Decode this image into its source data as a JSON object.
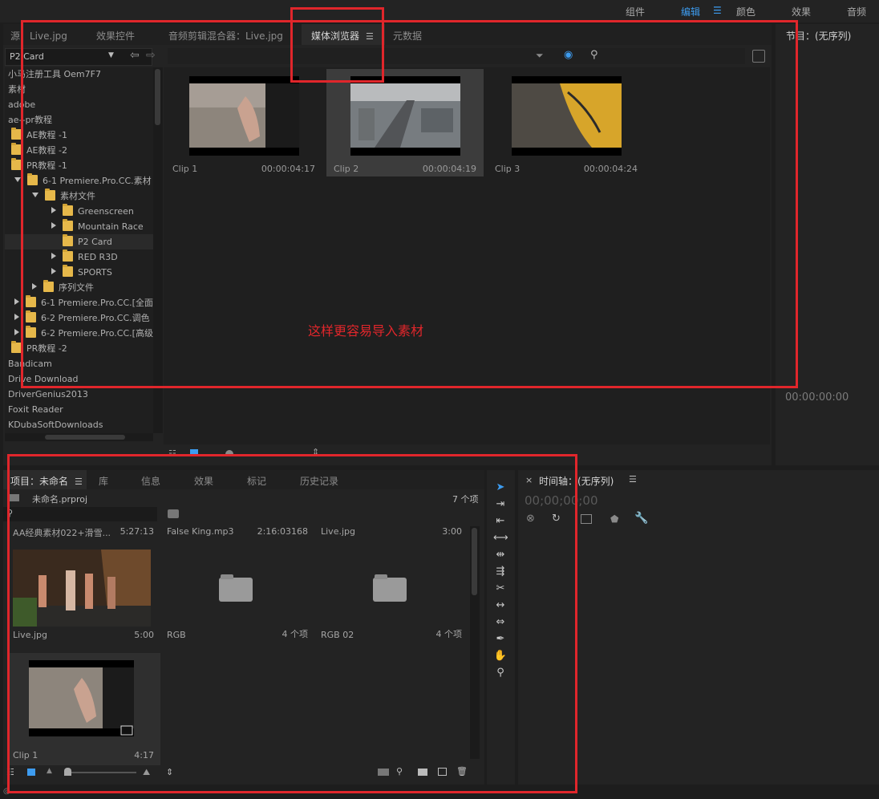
{
  "workspace_menu": {
    "items": [
      "组件",
      "编辑",
      "颜色",
      "效果",
      "音频"
    ],
    "active": "编辑"
  },
  "source_panel": {
    "tabs": [
      "源：Live.jpg",
      "效果控件",
      "音频剪辑混合器：Live.jpg",
      "媒体浏览器",
      "元数据"
    ],
    "active_tab": "媒体浏览器",
    "location_select": "P2 Card",
    "tree": [
      {
        "label": "小马注册工具 Oem7F7",
        "level": 0,
        "folder": false,
        "arrow": ""
      },
      {
        "label": "素材",
        "level": 0,
        "folder": false,
        "arrow": ""
      },
      {
        "label": "adobe",
        "level": 0,
        "folder": false,
        "arrow": ""
      },
      {
        "label": "ae--pr教程",
        "level": 0,
        "folder": false,
        "arrow": ""
      },
      {
        "label": "AE教程 -1",
        "level": 1,
        "folder": true,
        "arrow": ""
      },
      {
        "label": "AE教程 -2",
        "level": 1,
        "folder": true,
        "arrow": ""
      },
      {
        "label": "PR教程 -1",
        "level": 1,
        "folder": true,
        "arrow": ""
      },
      {
        "label": "6-1 Premiere.Pro.CC.素材",
        "level": 2,
        "folder": true,
        "arrow": "down"
      },
      {
        "label": "素材文件",
        "level": 3,
        "folder": true,
        "arrow": "down"
      },
      {
        "label": "Greenscreen",
        "level": 4,
        "folder": true,
        "arrow": "right"
      },
      {
        "label": "Mountain Race",
        "level": 4,
        "folder": true,
        "arrow": "right"
      },
      {
        "label": "P2 Card",
        "level": 4,
        "folder": true,
        "arrow": ""
      },
      {
        "label": "RED R3D",
        "level": 4,
        "folder": true,
        "arrow": "right"
      },
      {
        "label": "SPORTS",
        "level": 4,
        "folder": true,
        "arrow": "right"
      },
      {
        "label": "序列文件",
        "level": 3,
        "folder": true,
        "arrow": "right"
      },
      {
        "label": "6-1 Premiere.Pro.CC.[全面",
        "level": 2,
        "folder": true,
        "arrow": "right"
      },
      {
        "label": "6-2 Premiere.Pro.CC.调色",
        "level": 2,
        "folder": true,
        "arrow": "right"
      },
      {
        "label": "6-2 Premiere.Pro.CC.[高级",
        "level": 2,
        "folder": true,
        "arrow": "right"
      },
      {
        "label": "PR教程 -2",
        "level": 1,
        "folder": true,
        "arrow": ""
      },
      {
        "label": "Bandicam",
        "level": 0,
        "folder": false,
        "arrow": ""
      },
      {
        "label": "Drive Download",
        "level": 0,
        "folder": false,
        "arrow": ""
      },
      {
        "label": "DriverGenius2013",
        "level": 0,
        "folder": false,
        "arrow": ""
      },
      {
        "label": "Foxit Reader",
        "level": 0,
        "folder": false,
        "arrow": ""
      },
      {
        "label": "KDubaSoftDownloads",
        "level": 0,
        "folder": false,
        "arrow": ""
      }
    ],
    "clips": [
      {
        "name": "Clip 1",
        "duration": "00:00:04:17"
      },
      {
        "name": "Clip 2",
        "duration": "00:00:04:19"
      },
      {
        "name": "Clip 3",
        "duration": "00:00:04:24"
      }
    ],
    "annotation": "这样更容易导入素材"
  },
  "program_panel": {
    "title": "节目：(无序列)",
    "timecode": "00:00:00:00"
  },
  "project_panel": {
    "tabs": [
      "项目：未命名",
      "库",
      "信息",
      "效果",
      "标记",
      "历史记录"
    ],
    "active_tab": "项目：未命名",
    "file": "未命名.prproj",
    "count": "7 个项",
    "items": [
      {
        "name": "AA经典素材022+滑雪...",
        "meta": "5:27:13",
        "foot_l": "Live.jpg",
        "foot_r": "5:00"
      },
      {
        "name": "False King.mp3",
        "meta": "2:16:03168",
        "foot_l": "RGB",
        "foot_r": "4 个项"
      },
      {
        "name": "Live.jpg",
        "meta": "3:00",
        "foot_l": "RGB 02",
        "foot_r": "4 个项"
      },
      {
        "name": "",
        "meta": "",
        "foot_l": "Clip 1",
        "foot_r": "4:17"
      }
    ]
  },
  "timeline_panel": {
    "title": "时间轴：(无序列)",
    "timecode": "00;00;00;00"
  },
  "colors": {
    "accent": "#3d9cf0",
    "annotation_red": "#e0262b",
    "folder_yellow": "#e6b84a"
  }
}
